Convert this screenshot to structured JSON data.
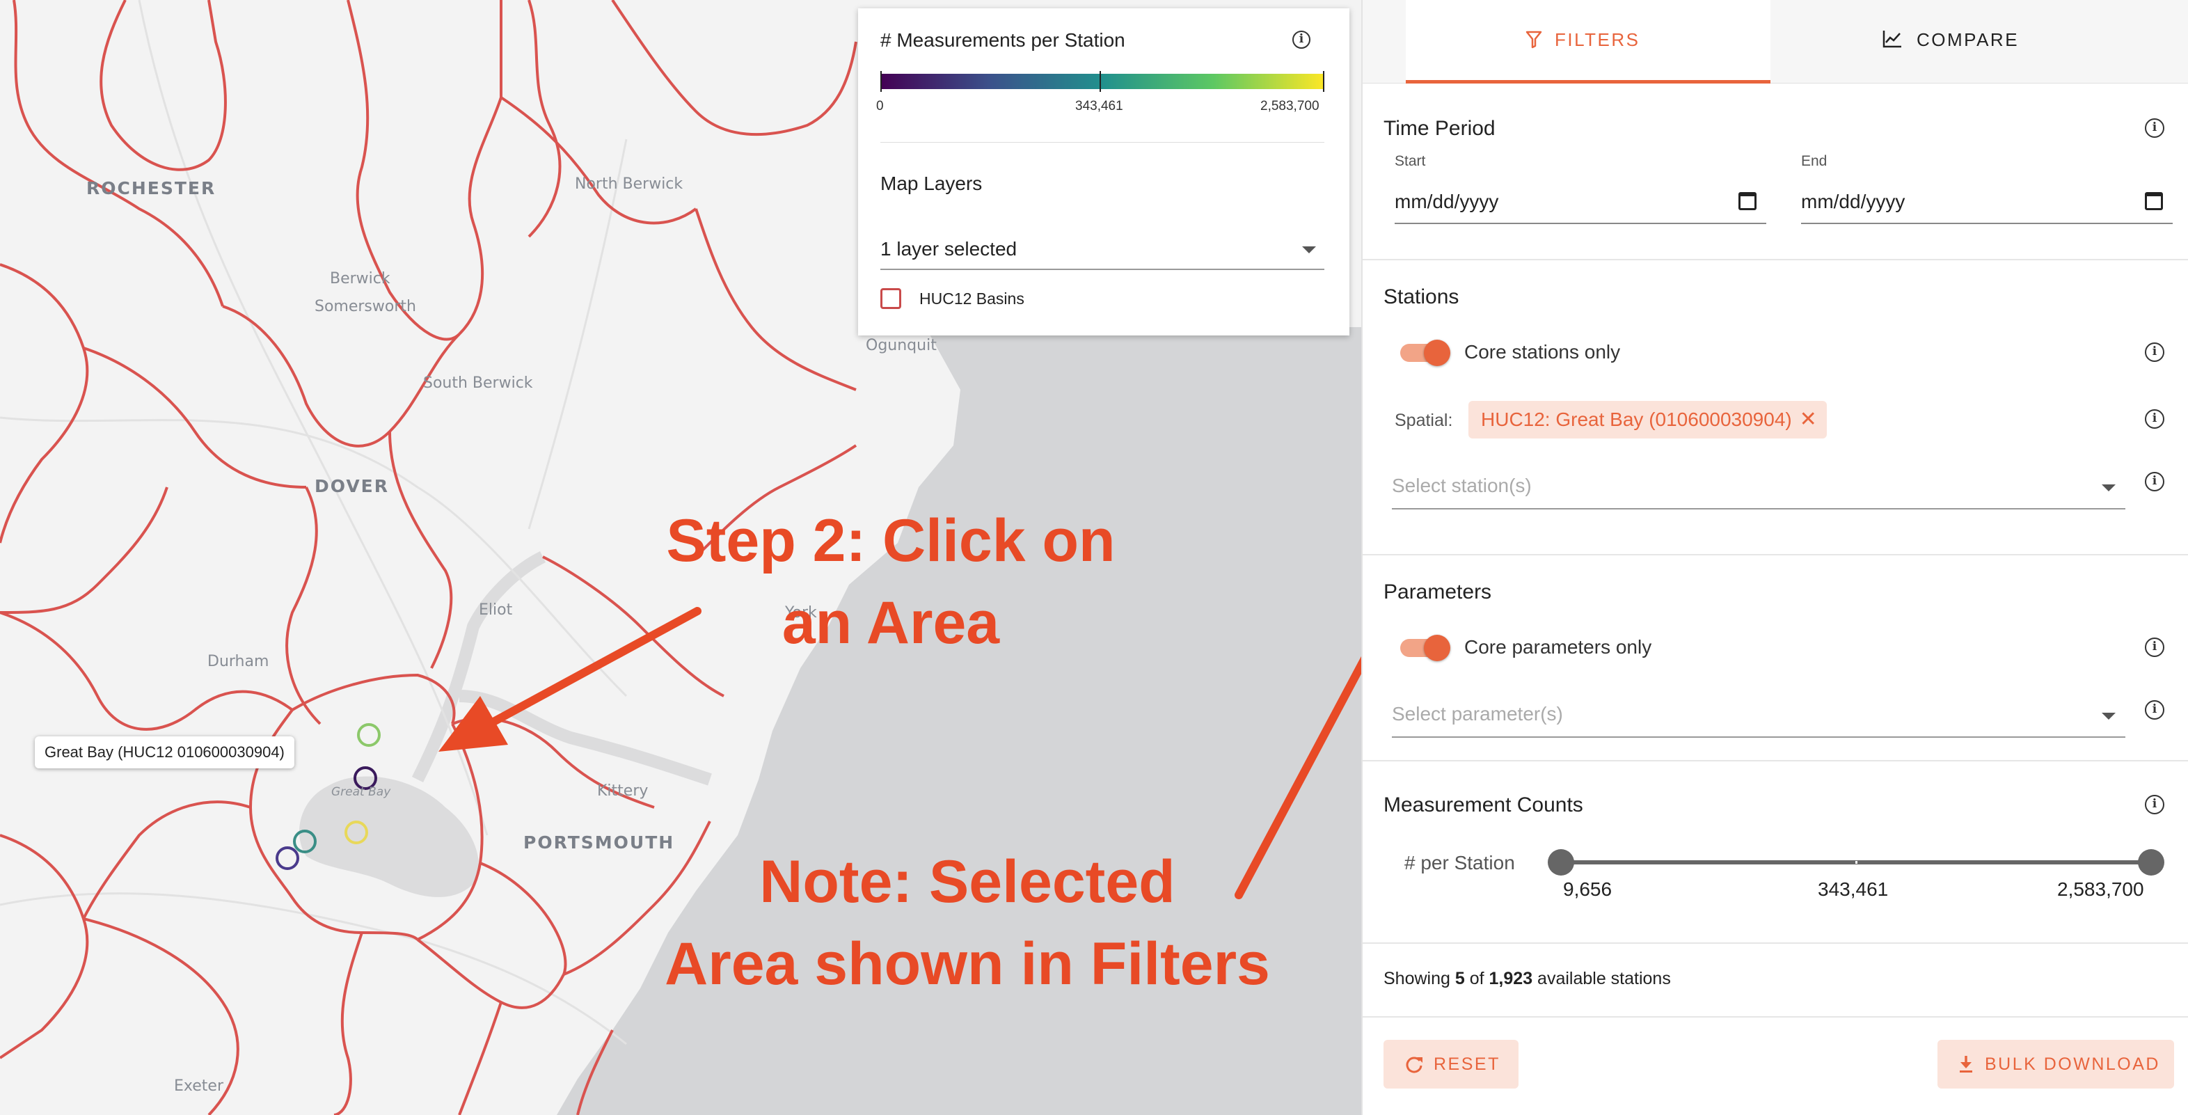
{
  "map": {
    "places": {
      "rochester": "ROCHESTER",
      "north_berwick": "North Berwick",
      "berwick": "Berwick",
      "somersworth": "Somersworth",
      "ogunquit": "Ogunquit",
      "south_berwick": "South Berwick",
      "dover": "DOVER",
      "eliot": "Eliot",
      "york": "York",
      "durham": "Durham",
      "great_bay": "Great Bay",
      "kittery": "Kittery",
      "portsmouth": "PORTSMOUTH",
      "exeter": "Exeter"
    },
    "tooltip": "Great Bay (HUC12 010600030904)",
    "station_colors": [
      "#8cc86a",
      "#3a1a5c",
      "#e8d85a",
      "#3a8e86",
      "#4a3a8c"
    ]
  },
  "legend": {
    "title": "# Measurements per Station",
    "colorbar": {
      "min_label": "0",
      "mid_label": "343,461",
      "max_label": "2,583,700",
      "colors": [
        "#440154",
        "#3b528b",
        "#21908d",
        "#5dc863",
        "#fde725"
      ]
    },
    "layers_title": "Map Layers",
    "layers_select": "1 layer selected",
    "layer_option": "HUC12 Basins"
  },
  "annotations": {
    "step2_line1": "Step 2: Click on",
    "step2_line2": "an Area",
    "note_line1": "Note: Selected",
    "note_line2": "Area shown in Filters",
    "color": "#e84a26"
  },
  "sidebar": {
    "tabs": [
      {
        "label": "FILTERS",
        "icon": "filter-icon",
        "active": true
      },
      {
        "label": "COMPARE",
        "icon": "chart-line-icon",
        "active": false
      }
    ],
    "time_period": {
      "title": "Time Period",
      "start_label": "Start",
      "start_placeholder": "mm/dd/yyyy",
      "end_label": "End",
      "end_placeholder": "mm/dd/yyyy"
    },
    "stations": {
      "title": "Stations",
      "core_only_label": "Core stations only",
      "core_only_on": true,
      "spatial_label": "Spatial:",
      "spatial_chip": "HUC12: Great Bay (010600030904)",
      "select_placeholder": "Select station(s)"
    },
    "parameters": {
      "title": "Parameters",
      "core_only_label": "Core parameters only",
      "core_only_on": true,
      "select_placeholder": "Select parameter(s)"
    },
    "measurement_counts": {
      "title": "Measurement Counts",
      "row_label": "# per Station",
      "min": "9,656",
      "mid": "343,461",
      "max": "2,583,700"
    },
    "showing": {
      "prefix": "Showing",
      "count": "5",
      "of": "of",
      "total": "1,923",
      "suffix": "available stations"
    },
    "reset_label": "RESET",
    "bulk_download_label": "BULK DOWNLOAD",
    "accent_color": "#e8643c"
  }
}
